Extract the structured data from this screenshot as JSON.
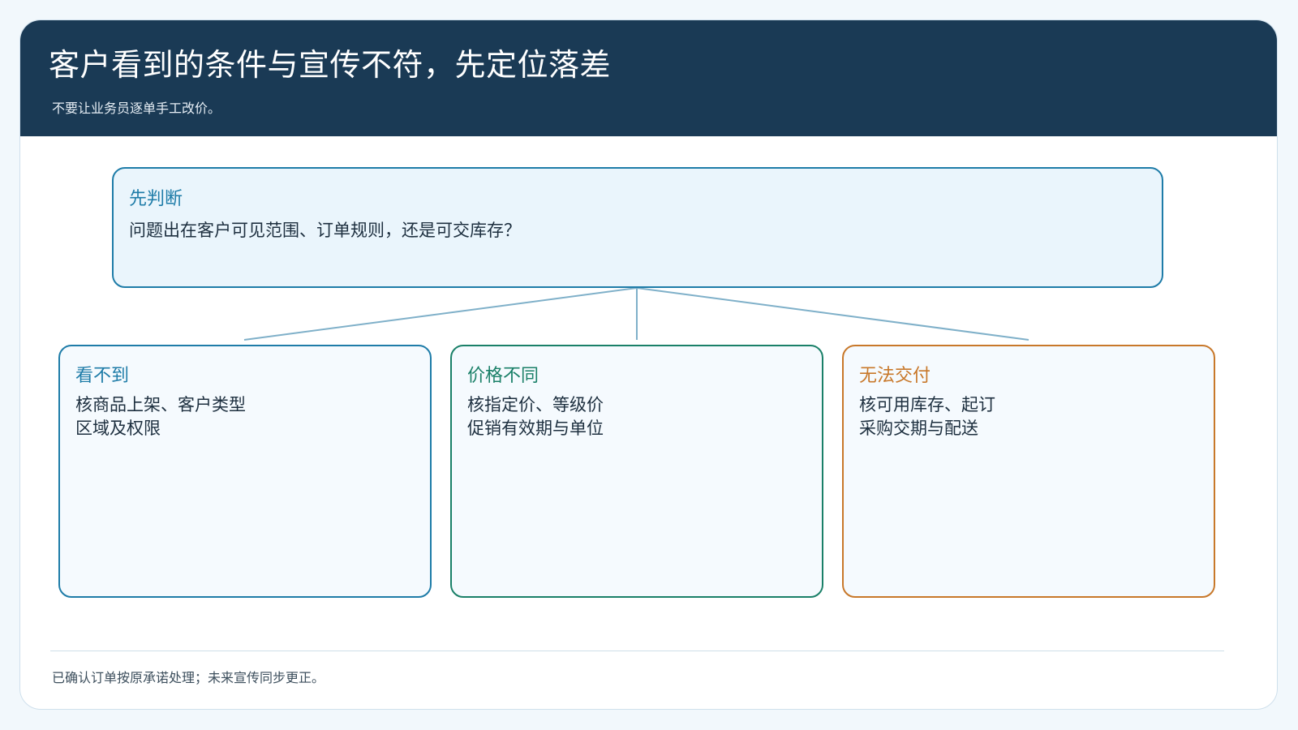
{
  "header": {
    "title": "客户看到的条件与宣传不符，先定位落差",
    "subtitle": "不要让业务员逐单手工改价。"
  },
  "decision": {
    "title": "先判断",
    "body": "问题出在客户可见范围、订单规则，还是可交库存？"
  },
  "branches": [
    {
      "title": "看不到",
      "lines": [
        "核商品上架、客户类型",
        "区域及权限"
      ],
      "color": "#1e7ca8"
    },
    {
      "title": "价格不同",
      "lines": [
        "核指定价、等级价",
        "促销有效期与单位"
      ],
      "color": "#1a8068"
    },
    {
      "title": "无法交付",
      "lines": [
        "核可用库存、起订",
        "采购交期与配送"
      ],
      "color": "#c8782a"
    }
  ],
  "footer": {
    "note": "已确认订单按原承诺处理；未来宣传同步更正。"
  },
  "colors": {
    "header_bg": "#1a3a55",
    "connector": "#7fb0c9"
  }
}
